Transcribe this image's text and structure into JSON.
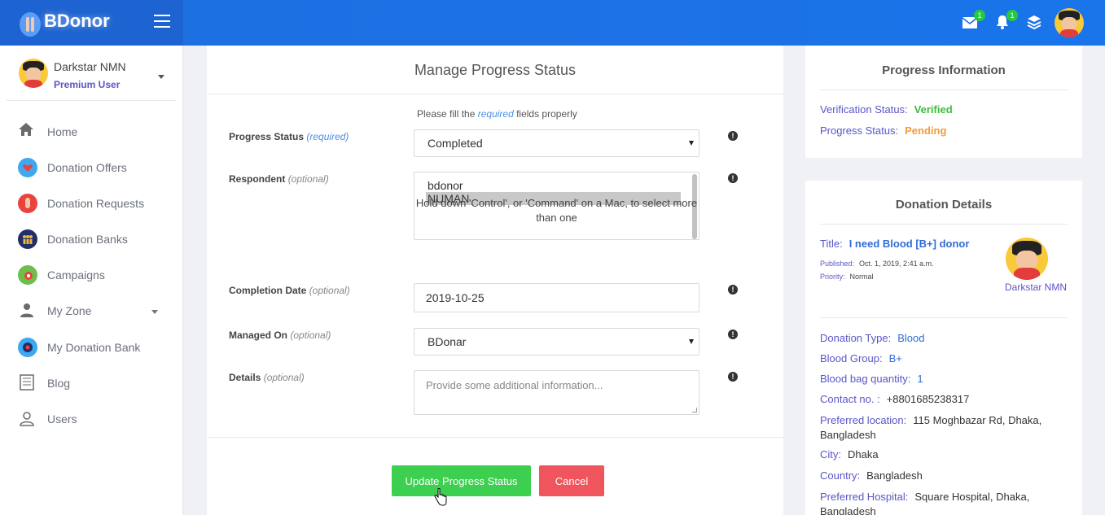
{
  "brand": {
    "name": "BDonor"
  },
  "topbar": {
    "mail_badge": "1",
    "bell_badge": "1"
  },
  "user": {
    "name": "Darkstar NMN",
    "role": "Premium User"
  },
  "sidebar": {
    "items": [
      {
        "label": "Home"
      },
      {
        "label": "Donation Offers"
      },
      {
        "label": "Donation Requests"
      },
      {
        "label": "Donation Banks"
      },
      {
        "label": "Campaigns"
      },
      {
        "label": "My Zone"
      },
      {
        "label": "My Donation Bank"
      },
      {
        "label": "Blog"
      },
      {
        "label": "Users"
      }
    ]
  },
  "form": {
    "title": "Manage Progress Status",
    "hint_prefix": "Please fill the ",
    "hint_required": "required",
    "hint_suffix": " fields properly",
    "progress_label": "Progress Status",
    "progress_tag": "(required)",
    "progress_value": "Completed",
    "respondent_label": "Respondent",
    "respondent_tag": "(optional)",
    "respondent_options": [
      "bdonor",
      "NUMAN"
    ],
    "respondent_help": "Hold down 'Control', or 'Command' on a Mac, to select more than one",
    "completion_label": "Completion Date",
    "completion_tag": "(optional)",
    "completion_value": "2019-10-25",
    "managed_label": "Managed On",
    "managed_tag": "(optional)",
    "managed_value": "BDonar",
    "details_label": "Details",
    "details_tag": "(optional)",
    "details_placeholder": "Provide some additional information...",
    "update_button": "Update Progress Status",
    "cancel_button": "Cancel"
  },
  "progress_info": {
    "title": "Progress Information",
    "verification_label": "Verification Status:",
    "verification_value": "Verified",
    "status_label": "Progress Status:",
    "status_value": "Pending"
  },
  "donation": {
    "title": "Donation Details",
    "title_label": "Title:",
    "title_value": "I need Blood [B+] donor",
    "published_label": "Published:",
    "published_value": "Oct. 1, 2019, 2:41 a.m.",
    "priority_label": "Priority:",
    "priority_value": "Normal",
    "author": "Darkstar NMN",
    "type_label": "Donation Type:",
    "type_value": "Blood",
    "group_label": "Blood Group:",
    "group_value": "B+",
    "qty_label": "Blood bag quantity:",
    "qty_value": "1",
    "contact_label": "Contact no. :",
    "contact_value": "+8801685238317",
    "location_label": "Preferred location:",
    "location_value": "115 Moghbazar Rd, Dhaka, Bangladesh",
    "city_label": "City:",
    "city_value": "Dhaka",
    "country_label": "Country:",
    "country_value": "Bangladesh",
    "hospital_label": "Preferred Hospital:",
    "hospital_value": "Square Hospital, Dhaka, Bangladesh"
  }
}
